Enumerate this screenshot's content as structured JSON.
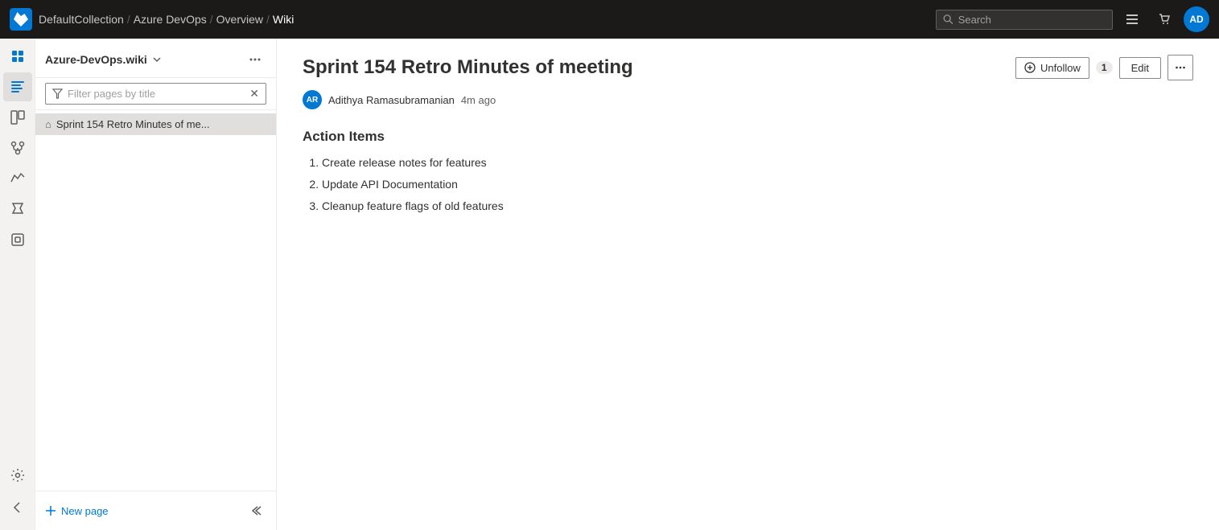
{
  "topbar": {
    "logo_text": "AD",
    "breadcrumb": [
      {
        "label": "DefaultCollection",
        "last": false
      },
      {
        "label": "Azure DevOps",
        "last": false
      },
      {
        "label": "Overview",
        "last": false
      },
      {
        "label": "Wiki",
        "last": true
      }
    ],
    "search_placeholder": "Search",
    "avatar_text": "AD"
  },
  "sidebar": {
    "wiki_title": "Azure-DevOps.wiki",
    "filter_placeholder": "Filter pages by title",
    "pages": [
      {
        "label": "Sprint 154 Retro Minutes of me...",
        "active": true
      }
    ],
    "new_page_label": "New page"
  },
  "content": {
    "page_title": "Sprint 154 Retro Minutes of meeting",
    "author_initials": "AR",
    "author_name": "Adithya Ramasubramanian",
    "time_ago": "4m ago",
    "unfollow_label": "Unfollow",
    "follower_count": "1",
    "edit_label": "Edit",
    "section_heading": "Action Items",
    "action_items": [
      "Create release notes for features",
      "Update API Documentation",
      "Cleanup feature flags of old features"
    ]
  }
}
